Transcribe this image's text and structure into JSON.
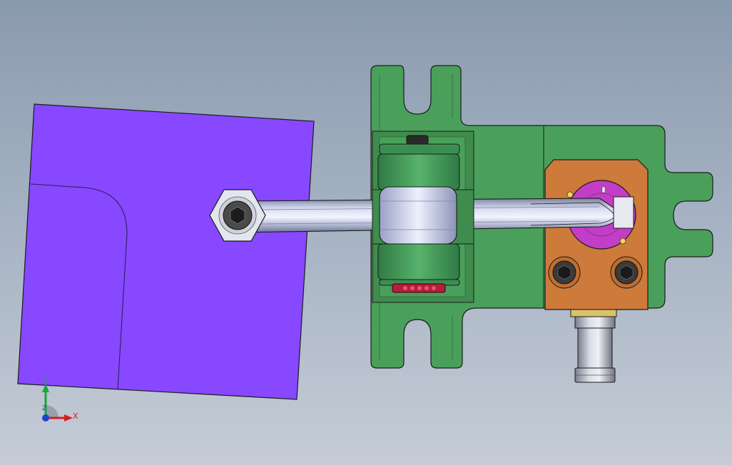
{
  "viewport": {
    "background_top": "#8a9aae",
    "background_bottom": "#c5ccd6"
  },
  "colors": {
    "plate": "#8748ff",
    "bracket": "#4aa05a",
    "roller": "#3e9e58",
    "block": "#cd7a3a",
    "disc": "#c23ec6",
    "steel": "#c8d0ea",
    "edge": "#1c1c1c"
  },
  "triad": {
    "x_label": "X",
    "y_label": "Y",
    "z_label": "Z",
    "x_color": "#d42020",
    "y_color": "#18a83a",
    "z_color": "#2040d0"
  }
}
